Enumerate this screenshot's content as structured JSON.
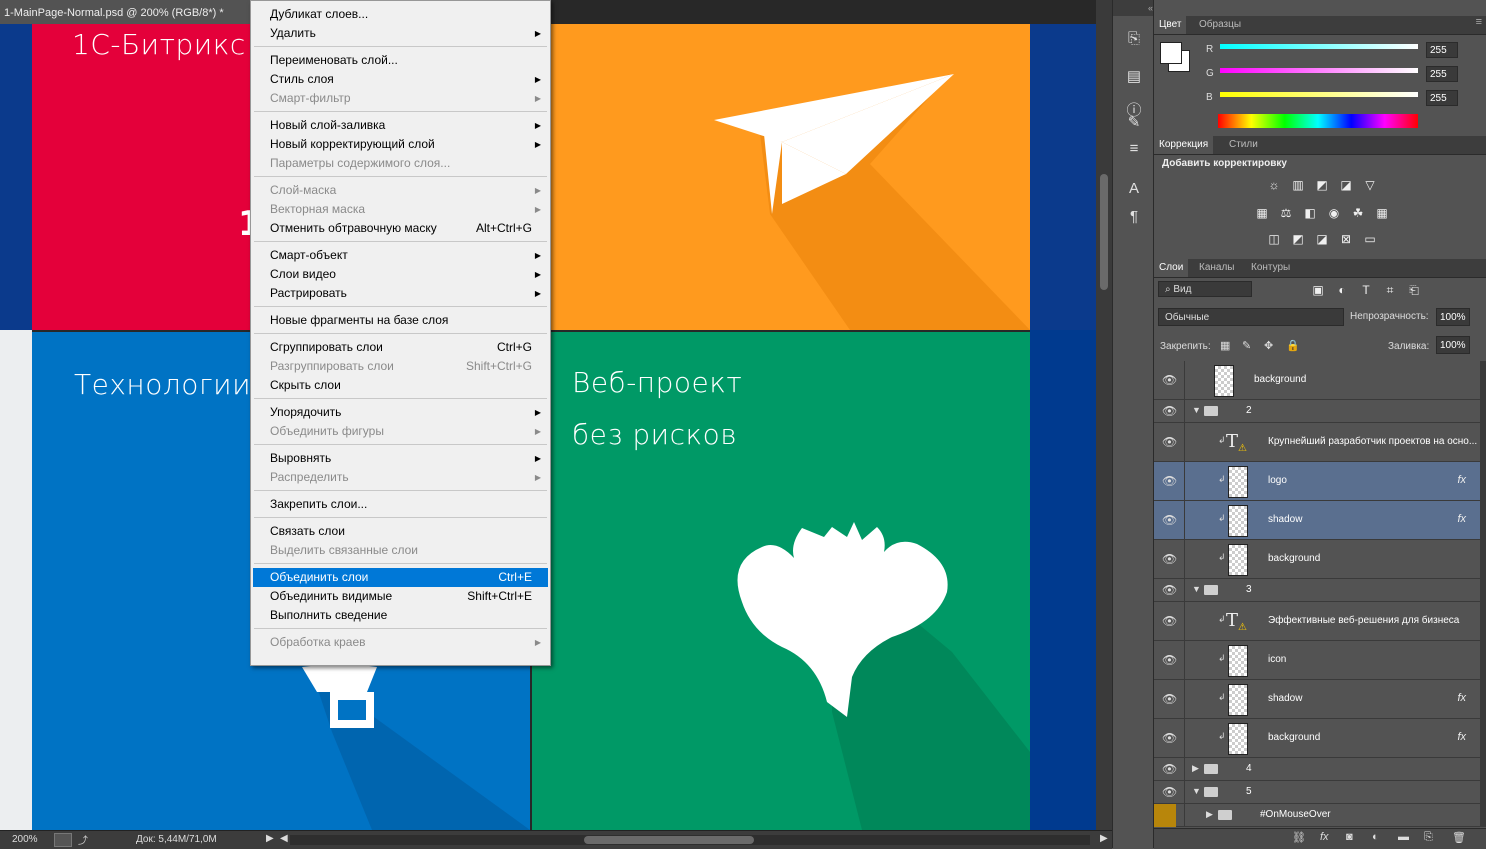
{
  "document": {
    "tab_title": "1-MainPage-Normal.psd @ 200% (RGB/8*) *",
    "tiles": {
      "top_left_text": "1С-Битрикс",
      "bottom_left_text": "Технологии",
      "bottom_right_line1": "Веб-проект",
      "bottom_right_line2": "без рисков",
      "red_glyph": "1"
    },
    "status": {
      "zoom": "200%",
      "doc_info": "Док: 5,44M/71,0M"
    }
  },
  "context_menu": {
    "items": [
      {
        "label": "Дубликат слоев...",
        "shortcut": "",
        "submenu": false,
        "disabled": false
      },
      {
        "label": "Удалить",
        "shortcut": "",
        "submenu": true,
        "disabled": false
      },
      {
        "label": "Переименовать слой...",
        "shortcut": "",
        "submenu": false,
        "disabled": false
      },
      {
        "label": "Стиль слоя",
        "shortcut": "",
        "submenu": true,
        "disabled": false
      },
      {
        "label": "Смарт-фильтр",
        "shortcut": "",
        "submenu": true,
        "disabled": true
      },
      {
        "label": "Новый слой-заливка",
        "shortcut": "",
        "submenu": true,
        "disabled": false
      },
      {
        "label": "Новый корректирующий слой",
        "shortcut": "",
        "submenu": true,
        "disabled": false
      },
      {
        "label": "Параметры содержимого слоя...",
        "shortcut": "",
        "submenu": false,
        "disabled": true
      },
      {
        "label": "Слой-маска",
        "shortcut": "",
        "submenu": true,
        "disabled": true
      },
      {
        "label": "Векторная маска",
        "shortcut": "",
        "submenu": true,
        "disabled": true
      },
      {
        "label": "Отменить обтравочную маску",
        "shortcut": "Alt+Ctrl+G",
        "submenu": false,
        "disabled": false
      },
      {
        "label": "Смарт-объект",
        "shortcut": "",
        "submenu": true,
        "disabled": false
      },
      {
        "label": "Слои видео",
        "shortcut": "",
        "submenu": true,
        "disabled": false
      },
      {
        "label": "Растрировать",
        "shortcut": "",
        "submenu": true,
        "disabled": false
      },
      {
        "label": "Новые фрагменты на базе слоя",
        "shortcut": "",
        "submenu": false,
        "disabled": false
      },
      {
        "label": "Сгруппировать слои",
        "shortcut": "Ctrl+G",
        "submenu": false,
        "disabled": false
      },
      {
        "label": "Разгруппировать слои",
        "shortcut": "Shift+Ctrl+G",
        "submenu": false,
        "disabled": true
      },
      {
        "label": "Скрыть слои",
        "shortcut": "",
        "submenu": false,
        "disabled": false
      },
      {
        "label": "Упорядочить",
        "shortcut": "",
        "submenu": true,
        "disabled": false
      },
      {
        "label": "Объединить фигуры",
        "shortcut": "",
        "submenu": true,
        "disabled": true
      },
      {
        "label": "Выровнять",
        "shortcut": "",
        "submenu": true,
        "disabled": false
      },
      {
        "label": "Распределить",
        "shortcut": "",
        "submenu": true,
        "disabled": true
      },
      {
        "label": "Закрепить слои...",
        "shortcut": "",
        "submenu": false,
        "disabled": false
      },
      {
        "label": "Связать слои",
        "shortcut": "",
        "submenu": false,
        "disabled": false
      },
      {
        "label": "Выделить связанные слои",
        "shortcut": "",
        "submenu": false,
        "disabled": true
      },
      {
        "label": "Объединить слои",
        "shortcut": "Ctrl+E",
        "submenu": false,
        "disabled": false,
        "selected": true
      },
      {
        "label": "Объединить видимые",
        "shortcut": "Shift+Ctrl+E",
        "submenu": false,
        "disabled": false
      },
      {
        "label": "Выполнить сведение",
        "shortcut": "",
        "submenu": false,
        "disabled": false
      },
      {
        "label": "Обработка краев",
        "shortcut": "",
        "submenu": true,
        "disabled": true
      }
    ]
  },
  "color_panel": {
    "tabs": [
      "Цвет",
      "Образцы"
    ],
    "channels": [
      {
        "label": "R",
        "value": "255"
      },
      {
        "label": "G",
        "value": "255"
      },
      {
        "label": "B",
        "value": "255"
      }
    ]
  },
  "adjustments_panel": {
    "tabs": [
      "Коррекция",
      "Стили"
    ],
    "heading": "Добавить корректировку"
  },
  "layers_panel": {
    "tabs": [
      "Слои",
      "Каналы",
      "Контуры"
    ],
    "filter_label": "Вид",
    "blend_mode": "Обычные",
    "opacity_label": "Непрозрачность:",
    "opacity_value": "100%",
    "lock_label": "Закрепить:",
    "fill_label": "Заливка:",
    "fill_value": "100%",
    "layers": [
      {
        "name": "background",
        "kind": "pixel",
        "indent": 0,
        "fx": false
      },
      {
        "name": "2",
        "kind": "group-open",
        "indent": 0,
        "fx": false
      },
      {
        "name": "Крупнейший разработчик проектов на осно...",
        "kind": "text",
        "indent": 1,
        "fx": false
      },
      {
        "name": "logo",
        "kind": "smart",
        "indent": 1,
        "fx": true,
        "selected": true
      },
      {
        "name": "shadow",
        "kind": "pixel",
        "indent": 1,
        "fx": true,
        "selected": true
      },
      {
        "name": "background",
        "kind": "pixel",
        "indent": 1,
        "fx": false
      },
      {
        "name": "3",
        "kind": "group-open",
        "indent": 0,
        "fx": false
      },
      {
        "name": "Эффективные веб-решения для бизнеса",
        "kind": "text",
        "indent": 1,
        "fx": false
      },
      {
        "name": "icon",
        "kind": "pixel",
        "indent": 1,
        "fx": false
      },
      {
        "name": "shadow",
        "kind": "pixel",
        "indent": 1,
        "fx": true
      },
      {
        "name": "background",
        "kind": "pixel",
        "indent": 1,
        "fx": true
      },
      {
        "name": "4",
        "kind": "group-closed",
        "indent": 0,
        "fx": false
      },
      {
        "name": "5",
        "kind": "group-open",
        "indent": 0,
        "fx": false
      },
      {
        "name": "#OnMouseOver",
        "kind": "group-closed",
        "indent": 1,
        "fx": false
      }
    ]
  },
  "colors": {
    "red_tile": "#e4003a",
    "orange_tile": "#ff9a1e",
    "blue_tile": "#0073c4",
    "green_tile": "#009966",
    "navy_bg": "#003a8f",
    "menu_highlight": "#0078d7",
    "layer_selected": "#5a6f8f"
  }
}
